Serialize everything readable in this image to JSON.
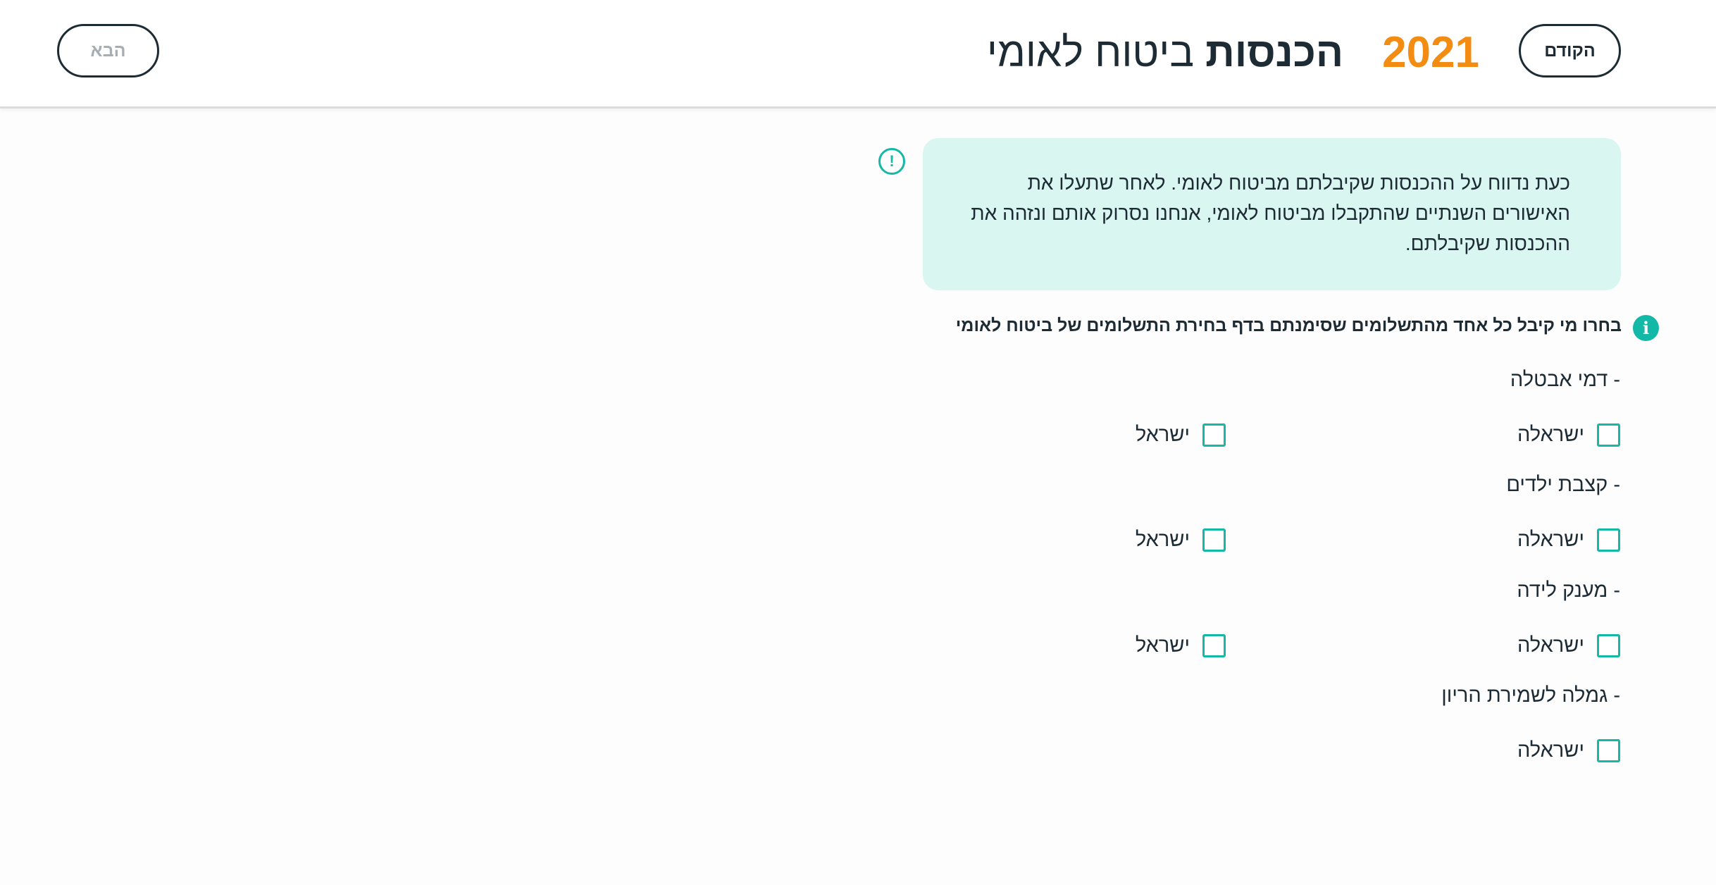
{
  "header": {
    "prev_label": "הקודם",
    "next_label": "הבא",
    "title_bold": "הכנסות",
    "title_rest": " ביטוח לאומי",
    "year": "2021"
  },
  "notice": {
    "icon": "exclamation-icon",
    "text": "כעת נדווח על ההכנסות שקיבלתם מביטוח לאומי. לאחר שתעלו את האישורים השנתיים שהתקבלו מביטוח לאומי, אנחנו נסרוק אותם ונזהה את ההכנסות שקיבלתם."
  },
  "instruction": {
    "icon": "info-icon",
    "text": "בחרו מי קיבל כל אחד מהתשלומים שסימנתם בדף בחירת התשלומים של ביטוח לאומי"
  },
  "categories": [
    {
      "label": "- דמי אבטלה",
      "options": [
        "ישראלה",
        "ישראל"
      ]
    },
    {
      "label": "- קצבת ילדים",
      "options": [
        "ישראלה",
        "ישראל"
      ]
    },
    {
      "label": "- מענק לידה",
      "options": [
        "ישראלה",
        "ישראל"
      ]
    },
    {
      "label": "- גמלה לשמירת הריון",
      "options": [
        "ישראלה"
      ]
    }
  ],
  "colors": {
    "accent": "#14b8a6",
    "year": "#f28c12",
    "notice_bg": "#d9f6f1",
    "text": "#1d2b35",
    "disabled": "#a7aeb3"
  }
}
